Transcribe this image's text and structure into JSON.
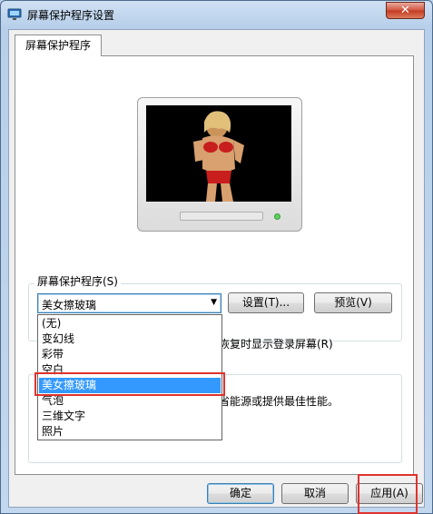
{
  "window": {
    "title": "屏幕保护程序设置",
    "close_label": "✕"
  },
  "tab": {
    "label": "屏幕保护程序"
  },
  "screensaver_group": {
    "legend": "屏幕保护程序(S)",
    "selected": "美女擦玻璃",
    "settings_button": "设置(T)...",
    "preview_button": "预览(V)",
    "checkbox_text": "恢复时显示登录屏幕(R)"
  },
  "dropdown": {
    "options": [
      "(无)",
      "变幻线",
      "彩带",
      "空白",
      "美女擦玻璃",
      "气泡",
      "三维文字",
      "照片"
    ],
    "selected_index": 4
  },
  "power": {
    "text": "省能源或提供最佳性能。"
  },
  "footer": {
    "ok": "确定",
    "cancel": "取消",
    "apply": "应用(A)"
  }
}
